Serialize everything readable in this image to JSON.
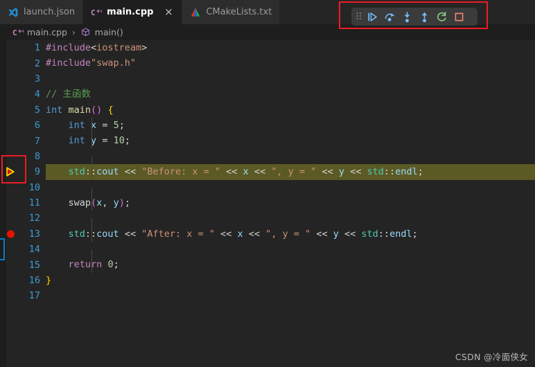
{
  "tabs": [
    {
      "label": "launch.json",
      "icon": "vscode-json-icon",
      "active": false,
      "closable": false
    },
    {
      "label": "main.cpp",
      "icon": "cpp-file-icon",
      "active": true,
      "closable": true,
      "close_label": "×"
    },
    {
      "label": "CMakeLists.txt",
      "icon": "cmake-file-icon",
      "active": false,
      "closable": false
    }
  ],
  "breadcrumb": {
    "file": "main.cpp",
    "separator": "›",
    "symbol": "main()"
  },
  "debug_toolbar": {
    "grip_label": "drag-handle",
    "buttons": [
      {
        "name": "continue-button",
        "title": "Continue",
        "color": "#75beff"
      },
      {
        "name": "step-over-button",
        "title": "Step Over",
        "color": "#75beff"
      },
      {
        "name": "step-into-button",
        "title": "Step Into",
        "color": "#75beff"
      },
      {
        "name": "step-out-button",
        "title": "Step Out",
        "color": "#75beff"
      },
      {
        "name": "restart-button",
        "title": "Restart",
        "color": "#89d185"
      },
      {
        "name": "stop-button",
        "title": "Stop",
        "color": "#f48771"
      }
    ]
  },
  "editor": {
    "language": "cpp",
    "current_line": 9,
    "breakpoint_lines": [
      13
    ],
    "lines": [
      {
        "n": "1",
        "text": "#include<iostream>"
      },
      {
        "n": "2",
        "text": "#include\"swap.h\""
      },
      {
        "n": "3",
        "text": ""
      },
      {
        "n": "4",
        "text": "// 主函数"
      },
      {
        "n": "5",
        "text": "int main() {"
      },
      {
        "n": "6",
        "text": "    int x = 5;"
      },
      {
        "n": "7",
        "text": "    int y = 10;"
      },
      {
        "n": "8",
        "text": ""
      },
      {
        "n": "9",
        "text": "    std::cout << \"Before: x = \" << x << \", y = \" << y << std::endl;"
      },
      {
        "n": "10",
        "text": ""
      },
      {
        "n": "11",
        "text": "    swap(x, y);"
      },
      {
        "n": "12",
        "text": ""
      },
      {
        "n": "13",
        "text": "    std::cout << \"After: x = \" << x << \", y = \" << y << std::endl;"
      },
      {
        "n": "14",
        "text": ""
      },
      {
        "n": "15",
        "text": "    return 0;"
      },
      {
        "n": "16",
        "text": "}"
      },
      {
        "n": "17",
        "text": ""
      }
    ]
  },
  "watermark": {
    "text": "CSDN @冷面侠女"
  },
  "colors": {
    "editor_background": "#242424",
    "tabbar_background": "#252526",
    "active_tab_background": "#1e1e1e",
    "line_highlight": "#5b5a25",
    "line_number": "#3d9bd4",
    "breakpoint": "#e51400",
    "execution_pointer": "#ffcc00",
    "annotation_box": "#ee1c25",
    "blue_marker": "#0a7ac8"
  }
}
